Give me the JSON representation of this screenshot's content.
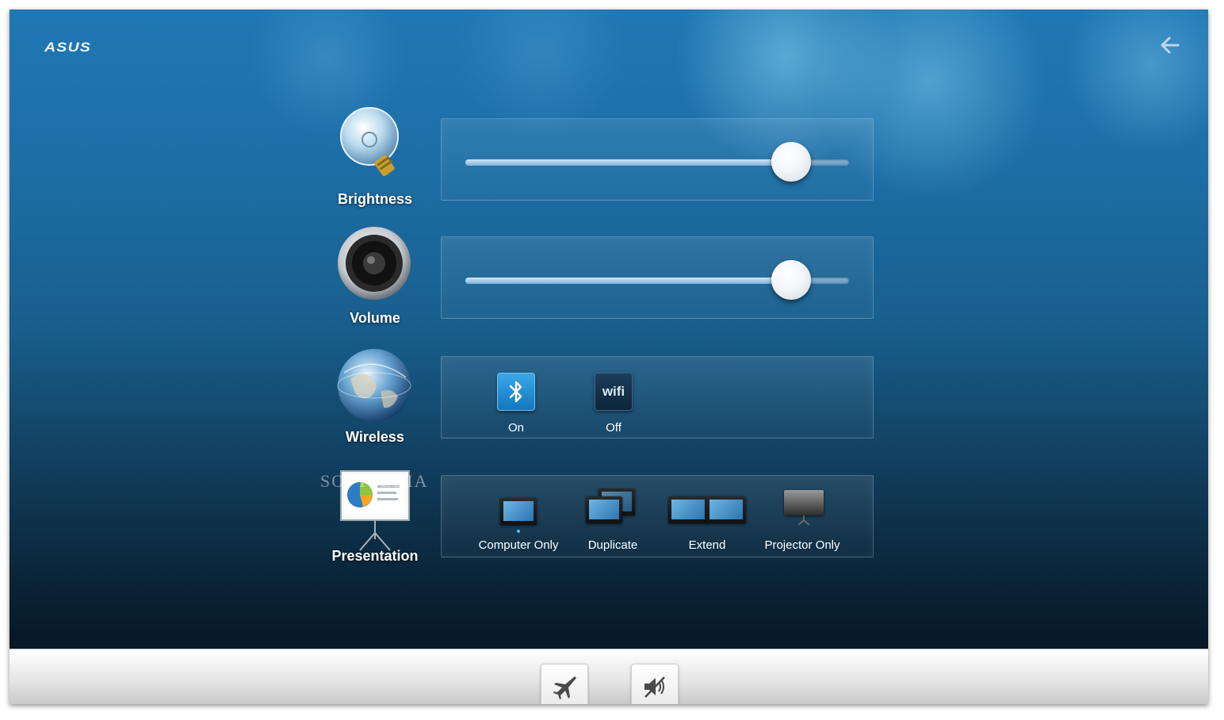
{
  "brand": {
    "logo_text": "ASUS"
  },
  "header": {
    "back_icon": "back-arrow-icon"
  },
  "rows": {
    "brightness": {
      "label": "Brightness",
      "icon": "lightbulb-icon",
      "level": 0.85
    },
    "volume": {
      "label": "Volume",
      "icon": "speaker-icon",
      "level": 0.85
    },
    "wireless": {
      "label": "Wireless",
      "icon": "globe-icon",
      "bluetooth": {
        "icon": "bluetooth-icon",
        "state": "On"
      },
      "wifi": {
        "icon_text": "wifi",
        "state": "Off"
      }
    },
    "presentation": {
      "label": "Presentation",
      "icon": "projector-screen-icon",
      "modes": [
        "Computer Only",
        "Duplicate",
        "Extend",
        "Projector Only"
      ],
      "selected": "Computer Only"
    }
  },
  "watermark": {
    "text": "SOFTPEDIA"
  },
  "bottom_bar": {
    "buttons": [
      "airplane-mode-icon",
      "mute-icon"
    ]
  },
  "colors": {
    "accent": "#1e8fd6",
    "background": "#1d6ea6"
  }
}
